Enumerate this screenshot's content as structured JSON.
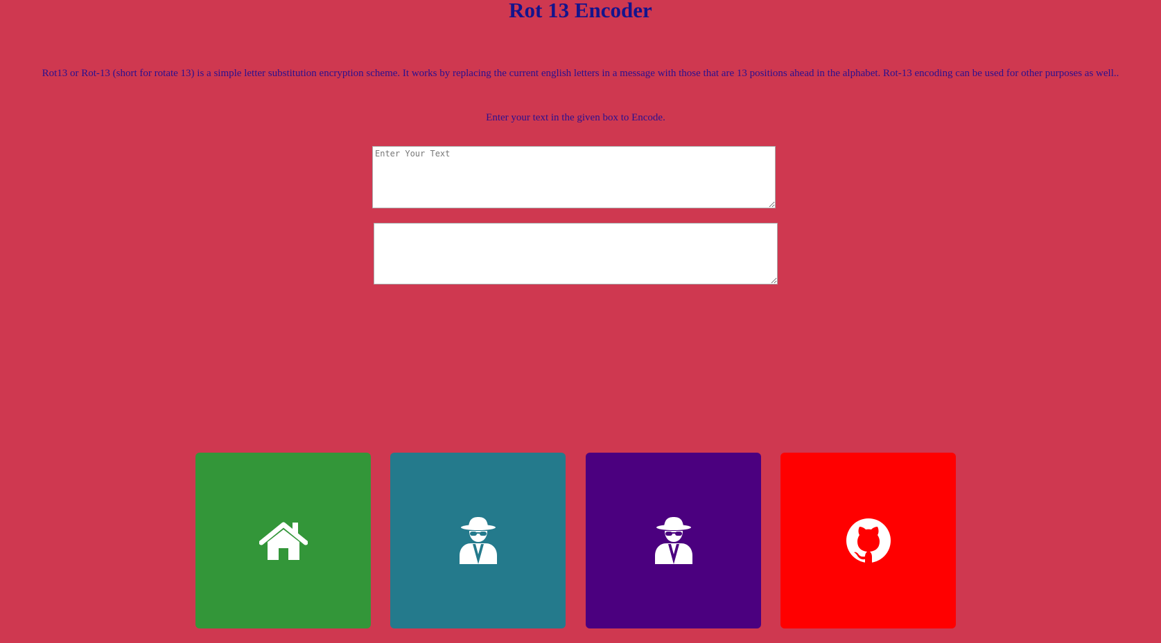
{
  "page": {
    "title": "Rot 13 Encoder",
    "description": "Rot13 or Rot-13 (short for rotate 13) is a simple letter substitution encryption scheme. It works by replacing the current english letters in a message with those that are 13 positions ahead in the alphabet. Rot-13 encoding can be used for other purposes as well..",
    "instruction": "Enter your text in the given box to Encode."
  },
  "input": {
    "placeholder": "Enter Your Text",
    "value": ""
  },
  "output": {
    "value": ""
  },
  "tiles": [
    {
      "icon": "home-icon",
      "color": "#339639"
    },
    {
      "icon": "spy-icon",
      "color": "#247a8c"
    },
    {
      "icon": "spy-icon",
      "color": "#4b007f"
    },
    {
      "icon": "github-icon",
      "color": "#ff0000"
    }
  ],
  "colors": {
    "background": "#cf3850",
    "title": "#14148c",
    "text": "#2a0f8f"
  }
}
